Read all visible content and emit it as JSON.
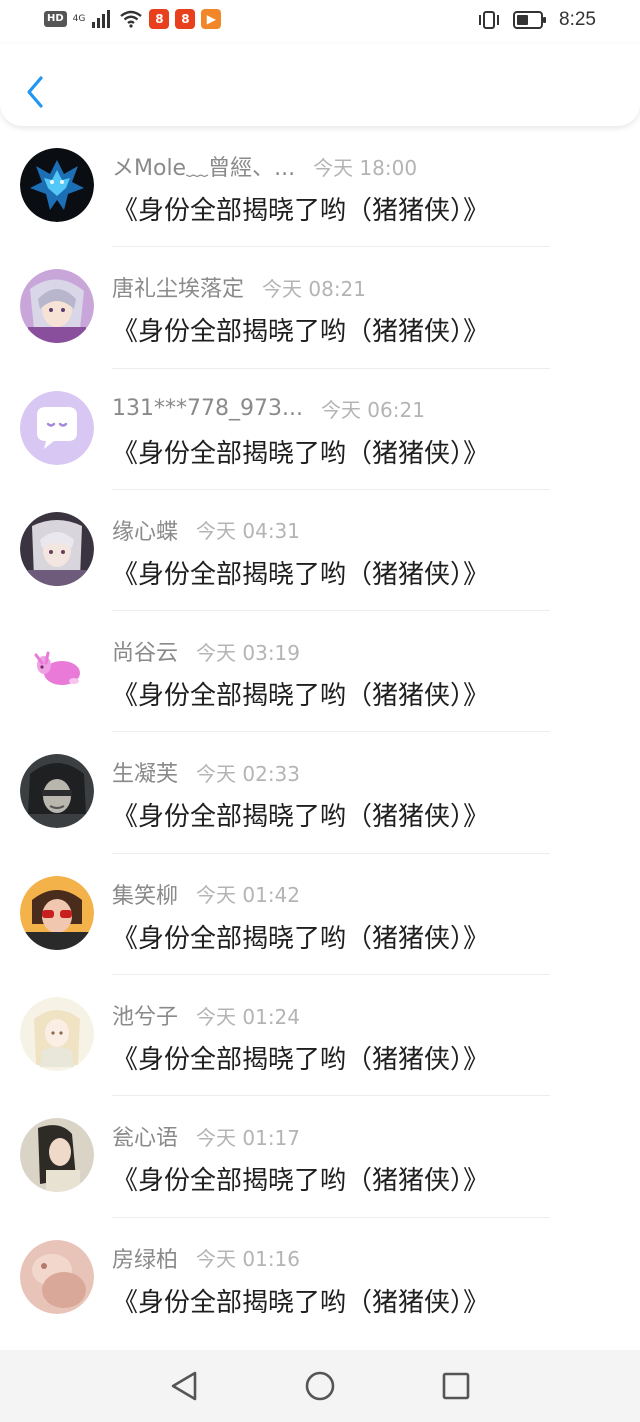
{
  "status_bar": {
    "hd_label": "HD",
    "network_label": "4G",
    "app_icon_1": "8",
    "app_icon_2": "8",
    "app_icon_3": "▶",
    "time": "8:25"
  },
  "header": {
    "back_icon": "chevron-left-icon",
    "accent_color": "#2196f3"
  },
  "messages": [
    {
      "username": "メMole﹏曾經、...",
      "time": "今天 18:00",
      "text": "《身份全部揭晓了哟（猪猪侠）》"
    },
    {
      "username": "唐礼尘埃落定",
      "time": "今天 08:21",
      "text": "《身份全部揭晓了哟（猪猪侠）》"
    },
    {
      "username": "131***778_973...",
      "time": "今天 06:21",
      "text": "《身份全部揭晓了哟（猪猪侠）》"
    },
    {
      "username": "缘心蝶",
      "time": "今天 04:31",
      "text": "《身份全部揭晓了哟（猪猪侠）》"
    },
    {
      "username": "尚谷云",
      "time": "今天 03:19",
      "text": "《身份全部揭晓了哟（猪猪侠）》"
    },
    {
      "username": "生凝芙",
      "time": "今天 02:33",
      "text": "《身份全部揭晓了哟（猪猪侠）》"
    },
    {
      "username": "集笑柳",
      "time": "今天 01:42",
      "text": "《身份全部揭晓了哟（猪猪侠）》"
    },
    {
      "username": "池兮子",
      "time": "今天 01:24",
      "text": "《身份全部揭晓了哟（猪猪侠）》"
    },
    {
      "username": "瓮心语",
      "time": "今天 01:17",
      "text": "《身份全部揭晓了哟（猪猪侠）》"
    },
    {
      "username": "房绿柏",
      "time": "今天 01:16",
      "text": "《身份全部揭晓了哟（猪猪侠）》"
    }
  ],
  "nav_bar": {
    "back_icon": "triangle-back-icon",
    "home_icon": "circle-home-icon",
    "recents_icon": "square-recents-icon"
  }
}
